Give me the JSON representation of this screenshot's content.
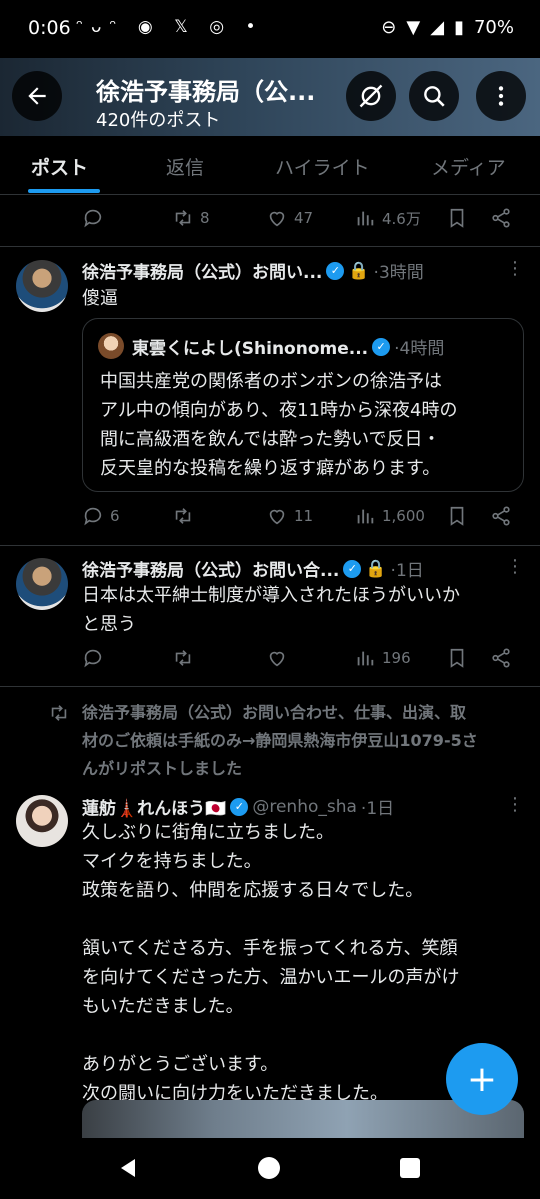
{
  "status_bar": {
    "time": "0:06",
    "battery": "70%"
  },
  "header": {
    "title": "徐浩予事務局（公...",
    "post_count": "420件のポスト"
  },
  "tabs": [
    "ポスト",
    "返信",
    "ハイライト",
    "メディア"
  ],
  "tweets": [
    {
      "replies": "",
      "retweets": "8",
      "likes": "47",
      "views": "4.6万"
    },
    {
      "name": "徐浩予事務局（公式）お問い...",
      "time": "·3時間",
      "text": "傻逼",
      "quote": {
        "name": "東雲くによし(Shinonome...",
        "time": "·4時間",
        "lines": [
          "中国共産党の関係者のボンボンの徐浩予は",
          "アル中の傾向があり、夜11時から深夜4時の",
          "間に高級酒を飲んでは酔った勢いで反日・",
          "反天皇的な投稿を繰り返す癖があります。"
        ]
      },
      "replies": "6",
      "retweets": "",
      "likes": "11",
      "views": "1,600"
    },
    {
      "name": "徐浩予事務局（公式）お問い合...",
      "time": "·1日",
      "lines": [
        "日本は太平紳士制度が導入されたほうがいいか",
        "と思う"
      ],
      "replies": "",
      "retweets": "",
      "likes": "",
      "views": "196"
    },
    {
      "repost_label_lines": [
        "徐浩予事務局（公式）お問い合わせ、仕事、出演、取",
        "材のご依頼は手紙のみ→静岡県熱海市伊豆山1079-5さ",
        "んがリポストしました"
      ],
      "name": "蓮舫🗼れんほう🇯🇵",
      "handle": "@renho_sha",
      "time": "·1日",
      "lines": [
        "久しぶりに街角に立ちました。",
        "マイクを持ちました。",
        "政策を語り、仲間を応援する日々でした。",
        "",
        "頷いてくださる方、手を振ってくれる方、笑顔",
        "を向けてくださった方、温かいエールの声がけ",
        "もいただきました。",
        "",
        "ありがとうございます。",
        "次の闘いに向け力をいただきました。"
      ]
    }
  ],
  "colors": {
    "accent": "#1d9bf0",
    "background": "#000000",
    "text": "#e7e9ea",
    "muted": "#71767b",
    "divider": "#2f3336"
  },
  "icons": [
    "back-arrow-icon",
    "no-sync-icon",
    "search-icon",
    "more-vertical-icon",
    "reply-icon",
    "retweet-icon",
    "like-icon",
    "views-icon",
    "bookmark-icon",
    "share-icon",
    "lock-icon",
    "verified-badge-icon",
    "compose-plus-icon"
  ]
}
